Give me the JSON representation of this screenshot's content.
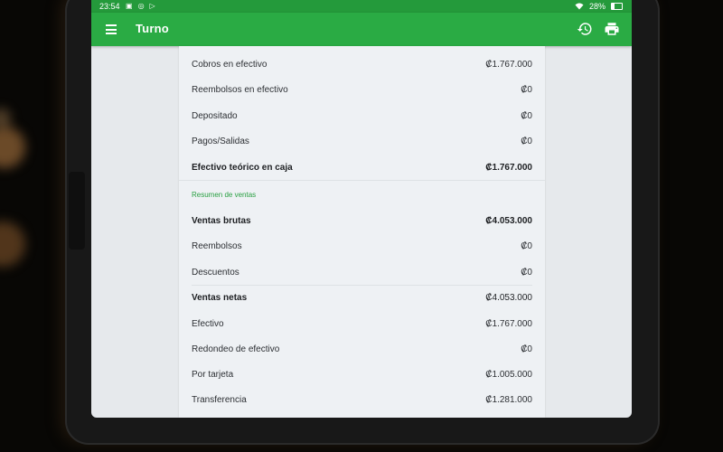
{
  "status_bar": {
    "time": "23:54",
    "battery": "28%",
    "left_icons": [
      "image-icon",
      "notification-icon",
      "play-icon"
    ],
    "right_icons": [
      "wifi-icon",
      "battery-icon"
    ]
  },
  "app_bar": {
    "title": "Turno",
    "color": "#2aab44",
    "actions": [
      "history-icon",
      "print-icon"
    ]
  },
  "cash_section": {
    "rows": [
      {
        "label": "Cobros en efectivo",
        "value": "₡1.767.000",
        "bold": false
      },
      {
        "label": "Reembolsos en efectivo",
        "value": "₡0",
        "bold": false
      },
      {
        "label": "Depositado",
        "value": "₡0",
        "bold": false
      },
      {
        "label": "Pagos/Salidas",
        "value": "₡0",
        "bold": false
      },
      {
        "label": "Efectivo teórico en caja",
        "value": "₡1.767.000",
        "bold": true
      }
    ]
  },
  "sales_section": {
    "title": "Resumen de ventas",
    "rows": [
      {
        "label": "Ventas brutas",
        "value": "₡4.053.000",
        "bold": true
      },
      {
        "label": "Reembolsos",
        "value": "₡0",
        "bold": false
      },
      {
        "label": "Descuentos",
        "value": "₡0",
        "bold": false
      },
      {
        "label": "Ventas netas",
        "value": "₡4.053.000",
        "bold": true
      },
      {
        "label": "Efectivo",
        "value": "₡1.767.000",
        "bold": false
      },
      {
        "label": "Redondeo de efectivo",
        "value": "₡0",
        "bold": false
      },
      {
        "label": "Por tarjeta",
        "value": "₡1.005.000",
        "bold": false
      },
      {
        "label": "Transferencia",
        "value": "₡1.281.000",
        "bold": false
      }
    ]
  }
}
